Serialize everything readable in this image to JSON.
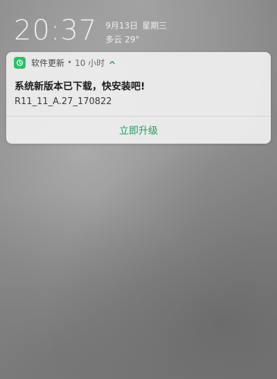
{
  "lockscreen": {
    "time": "20:37",
    "date": "9月13日",
    "weekday": "星期三",
    "weather": "多云 29°"
  },
  "notification": {
    "app_icon": "app-update-icon",
    "app_name": "软件更新",
    "separator": "•",
    "time_ago": "10 小时",
    "title": "系统新版本已下载，快安装吧!",
    "version": "R11_11_A.27_170822",
    "action_label": "立即升级"
  },
  "colors": {
    "accent": "#1aa35a",
    "icon_bg": "#2dbf6a"
  }
}
